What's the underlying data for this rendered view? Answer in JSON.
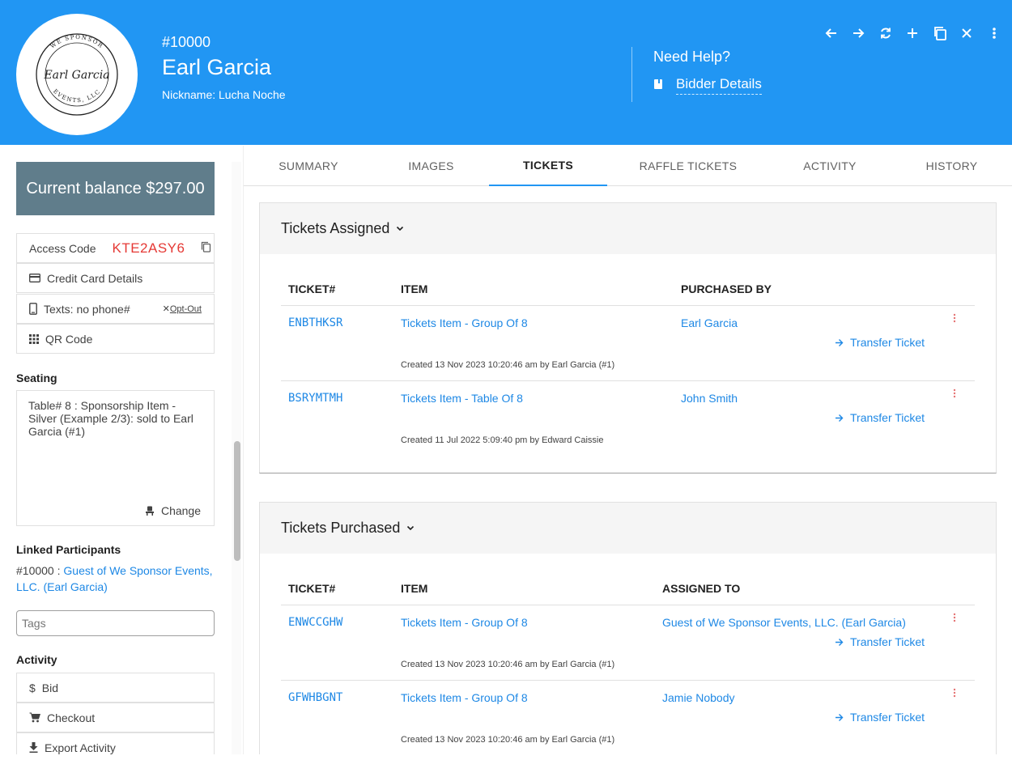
{
  "header": {
    "bidder_number": "#10000",
    "bidder_name": "Earl Garcia",
    "nickname": "Nickname: Lucha Noche",
    "logo": {
      "top_text": "WE SPONSOR",
      "script_text": "Earl Garcia",
      "bottom_text": "EVENTS, LLC"
    },
    "help_title": "Need Help?",
    "help_link": "Bidder Details",
    "toolbar_icons": [
      "arrow-left-icon",
      "arrow-right-icon",
      "refresh-icon",
      "plus-icon",
      "copy-icon",
      "close-icon",
      "more-vert-icon"
    ]
  },
  "sidebar": {
    "balance": "Current balance $297.00",
    "access_label": "Access Code",
    "access_code": "KTE2ASY6",
    "credit_card": "Credit Card Details",
    "texts": "Texts: no phone#",
    "opt_out": "Opt-Out",
    "qr_code": "QR Code",
    "seating_title": "Seating",
    "seating_text": "Table# 8 : Sponsorship Item - Silver (Example 2/3): sold to Earl Garcia (#1)",
    "change": "Change",
    "linked_title": "Linked Participants",
    "linked_prefix": "#10000 : ",
    "linked_link": "Guest of We Sponsor Events, LLC. (Earl Garcia)",
    "tags_placeholder": "Tags",
    "activity_title": "Activity",
    "activity_items": [
      "Bid",
      "Checkout",
      "Export Activity"
    ]
  },
  "tabs": [
    "SUMMARY",
    "IMAGES",
    "TICKETS",
    "RAFFLE TICKETS",
    "ACTIVITY",
    "HISTORY"
  ],
  "active_tab": "TICKETS",
  "assigned": {
    "title": "Tickets Assigned",
    "headers": [
      "TICKET#",
      "ITEM",
      "PURCHASED BY"
    ],
    "rows": [
      {
        "ticket": "ENBTHKSR",
        "item": "Tickets Item - Group Of 8",
        "person": "Earl Garcia",
        "transfer": "Transfer Ticket",
        "created": "Created 13 Nov 2023 10:20:46 am by Earl Garcia (#1)"
      },
      {
        "ticket": "BSRYMTMH",
        "item": "Tickets Item - Table Of 8",
        "person": "John Smith",
        "transfer": "Transfer Ticket",
        "created": "Created 11 Jul 2022 5:09:40 pm by Edward Caissie"
      }
    ]
  },
  "purchased": {
    "title": "Tickets Purchased",
    "headers": [
      "TICKET#",
      "ITEM",
      "ASSIGNED TO"
    ],
    "rows": [
      {
        "ticket": "ENWCCGHW",
        "item": "Tickets Item - Group Of 8",
        "person": "Guest of We Sponsor Events, LLC. (Earl Garcia)",
        "transfer": "Transfer Ticket",
        "created": "Created 13 Nov 2023 10:20:46 am by Earl Garcia (#1)"
      },
      {
        "ticket": "GFWHBGNT",
        "item": "Tickets Item - Group Of 8",
        "person": "Jamie Nobody",
        "transfer": "Transfer Ticket",
        "created": "Created 13 Nov 2023 10:20:46 am by Earl Garcia (#1)"
      }
    ]
  },
  "colors": {
    "header": "#2196f3",
    "balance": "#607d8b",
    "access_code": "#e53935",
    "link": "#1e88e5",
    "kebab": "#e57373"
  }
}
